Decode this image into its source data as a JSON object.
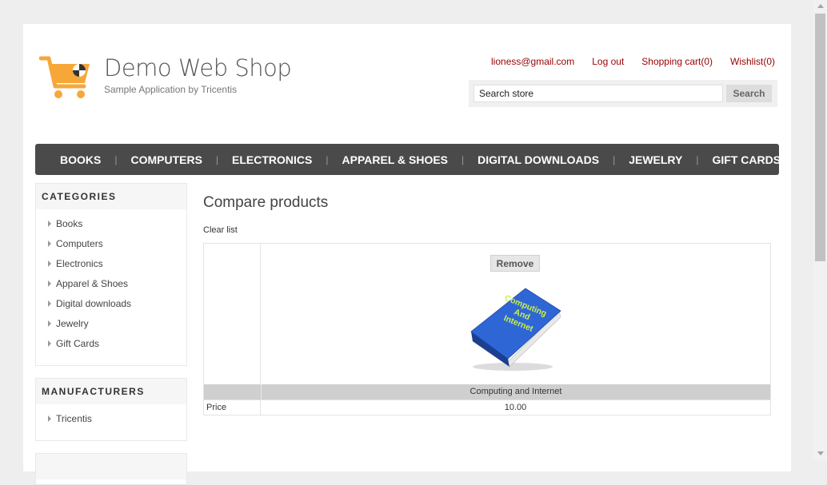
{
  "header": {
    "logo_title": "Demo Web Shop",
    "logo_subtitle": "Sample Application by Tricentis",
    "links": {
      "account": "lioness@gmail.com",
      "logout": "Log out",
      "cart": "Shopping cart(0)",
      "wishlist": "Wishlist(0)"
    },
    "search": {
      "value": "Search store",
      "button_label": "Search"
    }
  },
  "top_menu": {
    "items": [
      "BOOKS",
      "COMPUTERS",
      "ELECTRONICS",
      "APPAREL & SHOES",
      "DIGITAL DOWNLOADS",
      "JEWELRY",
      "GIFT CARDS"
    ]
  },
  "sidebar": {
    "categories": {
      "title": "CATEGORIES",
      "items": [
        "Books",
        "Computers",
        "Electronics",
        "Apparel & Shoes",
        "Digital downloads",
        "Jewelry",
        "Gift Cards"
      ]
    },
    "manufacturers": {
      "title": "MANUFACTURERS",
      "items": [
        "Tricentis"
      ]
    }
  },
  "main": {
    "title": "Compare products",
    "clear_list": "Clear list",
    "compare": {
      "remove_label": "Remove",
      "product_image_text": "Computing And Internet",
      "product_name": "Computing and Internet",
      "price_label": "Price",
      "price_value": "10.00"
    }
  },
  "colors": {
    "link_red": "#990000",
    "menu_bg": "#4a4a4a",
    "logo_orange": "#f7a738",
    "book_blue": "#2f66d6",
    "book_text": "#c8f04a"
  }
}
